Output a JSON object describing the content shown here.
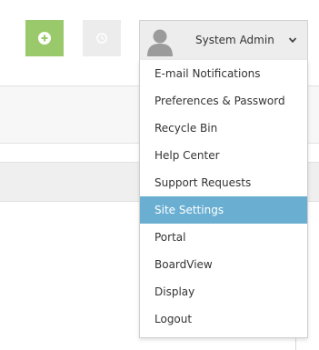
{
  "toolbar": {
    "add_icon": "plus-circle-icon",
    "clock_icon": "clock-icon",
    "add_color": "#9ac96b"
  },
  "user_menu": {
    "name": "System Admin",
    "avatar_icon": "user-avatar-icon",
    "toggle_icon": "chevron-down-icon",
    "active_color": "#6aafd2",
    "items": [
      {
        "label": "E-mail Notifications"
      },
      {
        "label": "Preferences & Password"
      },
      {
        "label": "Recycle Bin"
      },
      {
        "label": "Help Center"
      },
      {
        "label": "Support Requests"
      },
      {
        "label": "Site Settings",
        "active": true
      },
      {
        "label": "Portal"
      },
      {
        "label": "BoardView"
      },
      {
        "label": "Display"
      },
      {
        "label": "Logout"
      }
    ]
  }
}
